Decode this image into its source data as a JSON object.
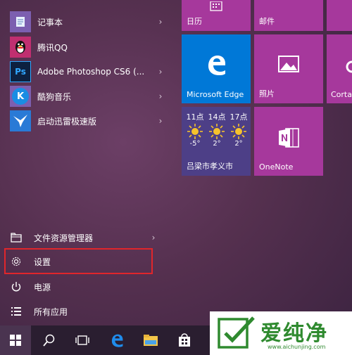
{
  "apps": [
    {
      "label": "记事本",
      "icon": "notepad-icon",
      "has_submenu": true
    },
    {
      "label": "腾讯QQ",
      "icon": "qq-penguin-icon",
      "has_submenu": false
    },
    {
      "label": "Adobe Photoshop CS6 (...",
      "icon": "photoshop-icon",
      "icon_text": "Ps",
      "has_submenu": true
    },
    {
      "label": "酷狗音乐",
      "icon": "kugou-music-icon",
      "icon_text": "K",
      "has_submenu": true
    },
    {
      "label": "启动迅雷极速版",
      "icon": "xunlei-bird-icon",
      "has_submenu": true
    }
  ],
  "system": {
    "file_explorer": "文件资源管理器",
    "settings": "设置",
    "power": "电源",
    "all_apps": "所有应用"
  },
  "tiles": {
    "calendar": "日历",
    "mail": "邮件",
    "edge": "Microsoft Edge",
    "photos": "照片",
    "cortana": "Corta",
    "onenote": "OneNote",
    "weather": {
      "location": "吕梁市孝义市",
      "days": [
        {
          "time": "11点",
          "temp": "-5°"
        },
        {
          "time": "14点",
          "temp": "2°"
        },
        {
          "time": "17点",
          "temp": "2°"
        }
      ]
    }
  },
  "watermark": {
    "brand": "爱纯净",
    "url": "www.aichunjing.com"
  },
  "colors": {
    "tile_purple": "#a6389c",
    "tile_blue": "#0078d7",
    "weather_tile": "#4d3f87",
    "highlight_red": "#e0262b",
    "watermark_green": "#2f8a2f"
  }
}
